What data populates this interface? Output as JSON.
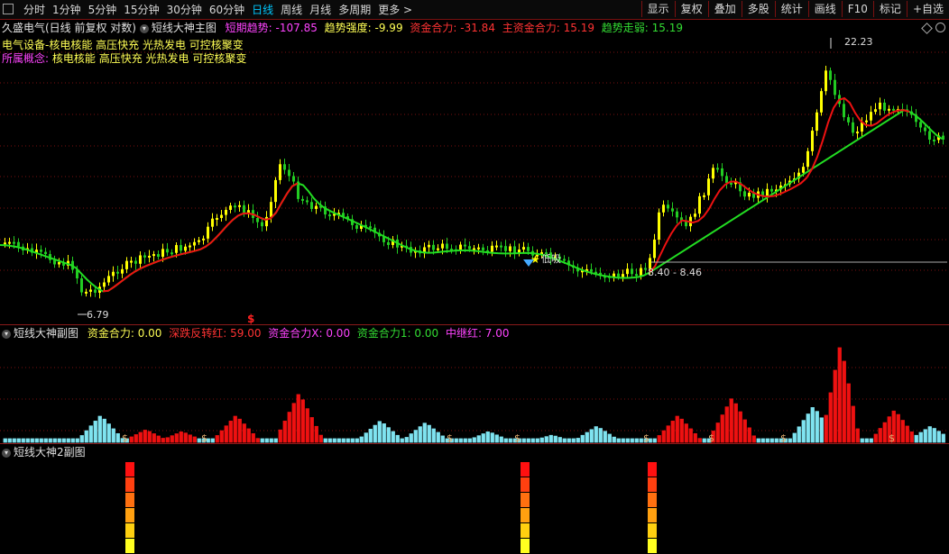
{
  "toolbar": {
    "periods": [
      "分时",
      "1分钟",
      "5分钟",
      "15分钟",
      "30分钟",
      "60分钟",
      "日线",
      "周线",
      "月线",
      "多周期",
      "更多 >"
    ],
    "active_index": 6,
    "right": [
      "显示",
      "复权",
      "叠加",
      "多股",
      "统计",
      "画线",
      "F10",
      "标记",
      "+自选"
    ]
  },
  "main": {
    "stock": "久盛电气(日线 前复权 对数)",
    "indicator_name": "短线大神主图",
    "items": [
      {
        "label": "短期趋势",
        "value": "-107.85",
        "color": "#ff44ff"
      },
      {
        "label": "趋势强度",
        "value": "-9.99",
        "color": "#ffff55"
      },
      {
        "label": "资金合力",
        "value": "-31.84",
        "color": "#ff3333"
      },
      {
        "label": "主资金合力",
        "value": "15.19",
        "color": "#ff3333"
      },
      {
        "label": "趋势走弱",
        "value": "15.19",
        "color": "#33dd33"
      }
    ],
    "concept_line1": "电气设备-核电核能 高压快充 光热发电 可控核聚变",
    "concept_label": "所属概念:",
    "concept_line2": "核电核能 高压快充 光热发电 可控核聚变",
    "high_label": "22.23",
    "low_label": "6.79",
    "range_label": "8.40 - 8.46",
    "signal_label": "低吸",
    "dollar": "$"
  },
  "sub1": {
    "name": "短线大神副图",
    "items": [
      {
        "label": "资金合力",
        "value": "0.00",
        "color": "#ffff55"
      },
      {
        "label": "深跌反转红",
        "value": "59.00",
        "color": "#ff3333"
      },
      {
        "label": "资金合力X",
        "value": "0.00",
        "color": "#ff44ff"
      },
      {
        "label": "资金合力1",
        "value": "0.00",
        "color": "#33dd33"
      },
      {
        "label": "中继红",
        "value": "7.00",
        "color": "#ff44ff"
      }
    ]
  },
  "sub2": {
    "name": "短线大神2副图"
  },
  "colors": {
    "up_yellow": "#ffff00",
    "down_green": "#22cc22",
    "ma_red": "#ee1111",
    "ma_green": "#22dd22",
    "bar_red": "#ee1111",
    "bar_cyan": "#7fe3f0",
    "grid": "#7a1010"
  }
}
